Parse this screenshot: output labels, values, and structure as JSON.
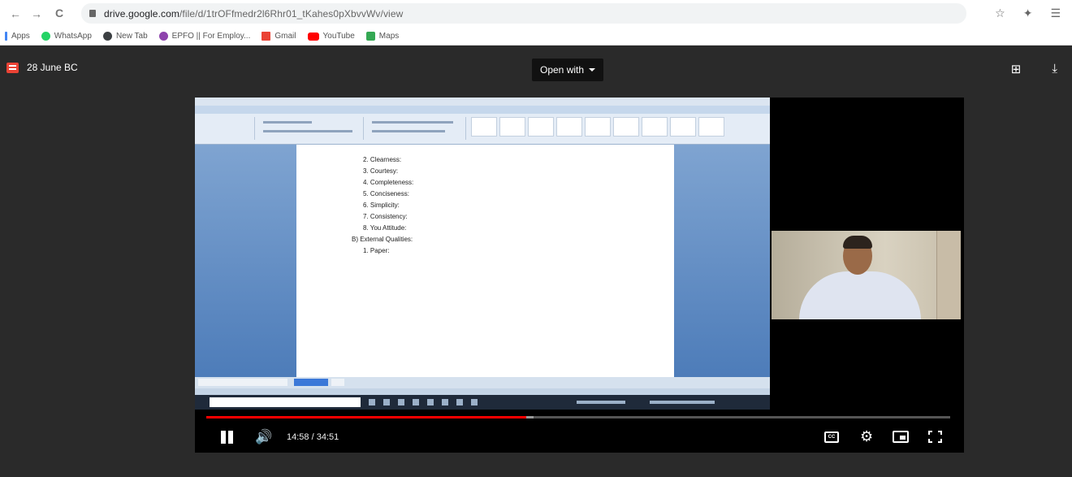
{
  "browser": {
    "url_host": "drive.google.com",
    "url_path": "/file/d/1trOFfmedr2l6Rhr01_tKahes0pXbvvWv/view",
    "nav": {
      "back": "←",
      "forward": "→",
      "reload": "C"
    },
    "top_icons": [
      "☆",
      "✦",
      "☰"
    ]
  },
  "bookmarks": [
    {
      "label": "Apps",
      "color": "#4285f4"
    },
    {
      "label": "WhatsApp",
      "color": "#25d366"
    },
    {
      "label": "New Tab",
      "color": "#3c4043"
    },
    {
      "label": "EPFO || For Employ...",
      "color": "#8e44ad"
    },
    {
      "label": "Gmail",
      "color": "#ea4335"
    },
    {
      "label": "YouTube",
      "color": "#ff0000"
    },
    {
      "label": "Maps",
      "color": "#34a853"
    }
  ],
  "viewer": {
    "file_name": "28 June BC",
    "open_with": "Open with",
    "icons": {
      "add": "⊞",
      "download": "⤓"
    }
  },
  "document": {
    "lines": [
      "2. Clearness:",
      "3. Courtesy:",
      "4. Completeness:",
      "5. Conciseness:",
      "6. Simplicity:",
      "7. Consistency:",
      "8. You Attitude:",
      "B) External Qualities:",
      "1. Paper:"
    ]
  },
  "player": {
    "current_time": "14:58",
    "duration": "34:51",
    "played_fraction": 0.43,
    "loaded_fraction": 0.44,
    "cc_label": "CC",
    "colors": {
      "progress": "#ff0000"
    }
  }
}
